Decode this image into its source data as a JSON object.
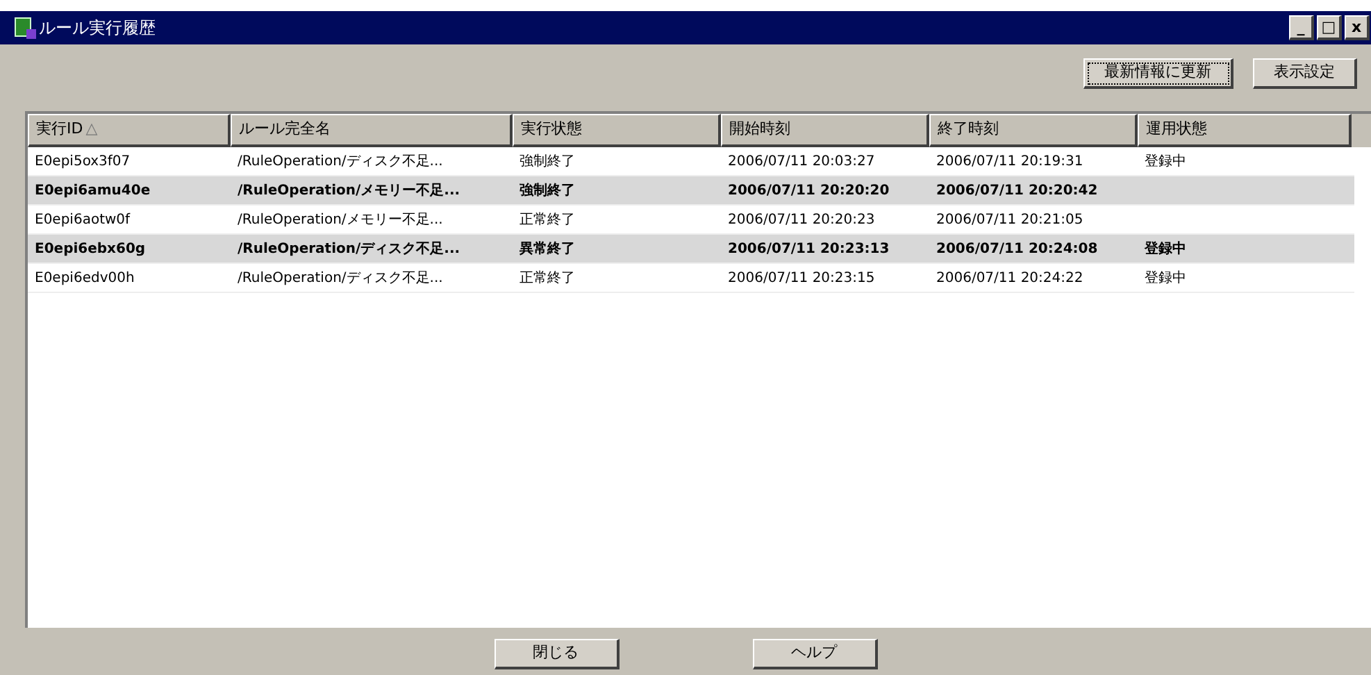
{
  "window": {
    "title": "ルール実行履歴",
    "controls": [
      "_",
      "□",
      "x"
    ]
  },
  "toolbar": {
    "buttons": [
      {
        "label": "最新情報に更新",
        "focused": true
      },
      {
        "label": "表示設定",
        "focused": false
      }
    ]
  },
  "table": {
    "columns": [
      {
        "label": "実行ID",
        "sort": "△"
      },
      {
        "label": "ルール完全名"
      },
      {
        "label": "実行状態"
      },
      {
        "label": "開始時刻"
      },
      {
        "label": "終了時刻"
      },
      {
        "label": "運用状態"
      }
    ],
    "rows": [
      {
        "selected": false,
        "cells": [
          "E0epi5ox3f07",
          "/RuleOperation/ディスク不足...",
          "強制終了",
          "2006/07/11 20:03:27",
          "2006/07/11 20:19:31",
          "登録中"
        ]
      },
      {
        "selected": true,
        "cells": [
          "E0epi6amu40e",
          "/RuleOperation/メモリー不足...",
          "強制終了",
          "2006/07/11 20:20:20",
          "2006/07/11 20:20:42",
          ""
        ]
      },
      {
        "selected": false,
        "cells": [
          "E0epi6aotw0f",
          "/RuleOperation/メモリー不足...",
          "正常終了",
          "2006/07/11 20:20:23",
          "2006/07/11 20:21:05",
          ""
        ]
      },
      {
        "selected": true,
        "cells": [
          "E0epi6ebx60g",
          "/RuleOperation/ディスク不足...",
          "異常終了",
          "2006/07/11 20:23:13",
          "2006/07/11 20:24:08",
          "登録中"
        ]
      },
      {
        "selected": false,
        "cells": [
          "E0epi6edv00h",
          "/RuleOperation/ディスク不足...",
          "正常終了",
          "2006/07/11 20:23:15",
          "2006/07/11 20:24:22",
          "登録中"
        ]
      }
    ]
  },
  "footer": {
    "buttons": [
      "閉じる",
      "ヘルプ"
    ]
  }
}
